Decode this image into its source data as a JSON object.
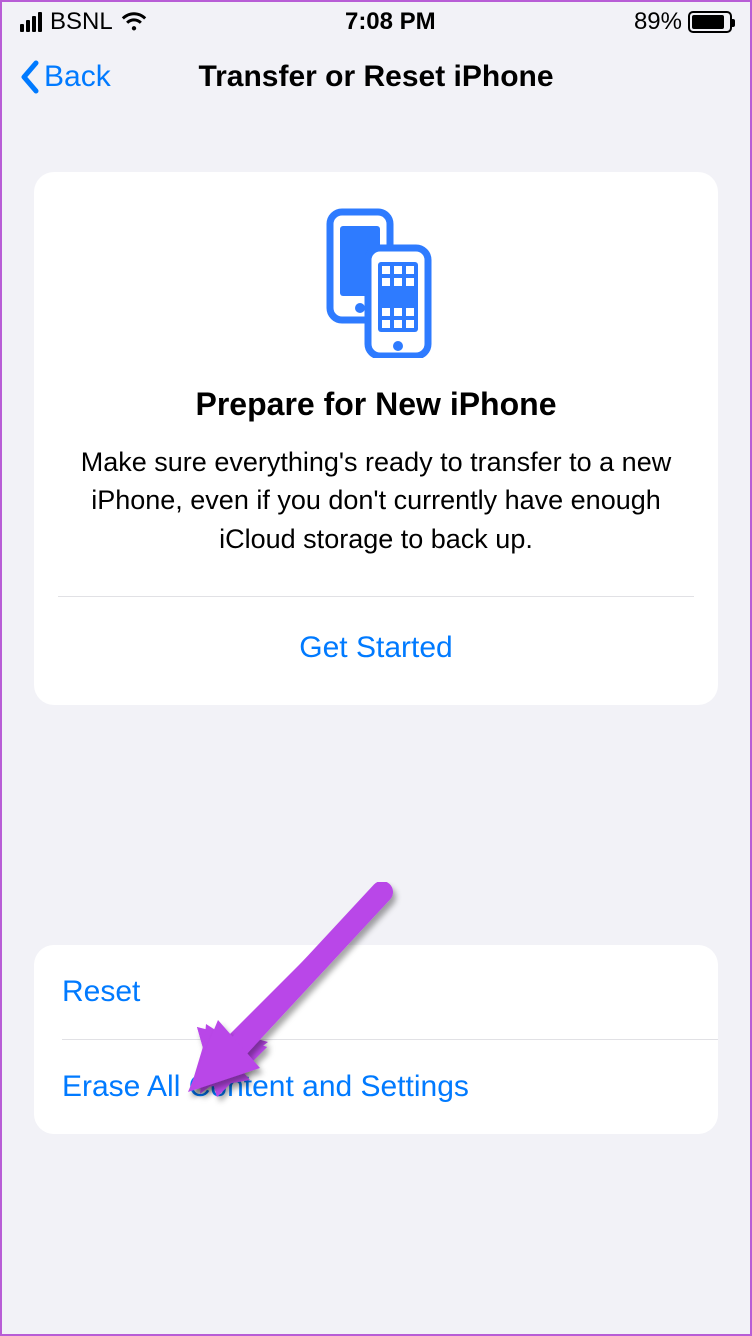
{
  "status": {
    "carrier": "BSNL",
    "time": "7:08 PM",
    "battery_pct": "89%"
  },
  "nav": {
    "back_label": "Back",
    "title": "Transfer or Reset iPhone"
  },
  "prepare_card": {
    "title": "Prepare for New iPhone",
    "body": "Make sure everything's ready to transfer to a new iPhone, even if you don't currently have enough iCloud storage to back up.",
    "action": "Get Started"
  },
  "options": {
    "reset": "Reset",
    "erase": "Erase All Content and Settings"
  },
  "colors": {
    "link": "#007aff",
    "annotation": "#b946e8"
  }
}
